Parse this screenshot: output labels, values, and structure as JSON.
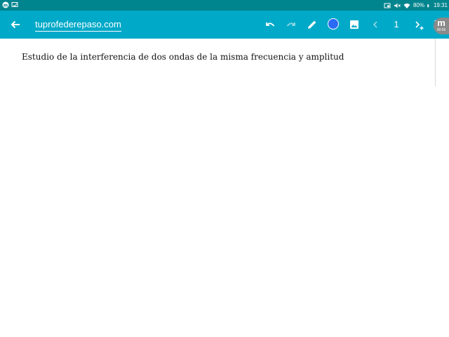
{
  "status_bar": {
    "battery": "80%",
    "time": "19:31"
  },
  "toolbar": {
    "url": "tuprofederepaso.com",
    "page_number": "1",
    "color": "#2a6af5",
    "icons": [
      "back-arrow-icon",
      "undo-icon",
      "redo-icon",
      "pencil-icon",
      "color-picker",
      "image-icon",
      "previous-page-icon",
      "page-number",
      "next-page-add-icon",
      "more-icon"
    ]
  },
  "floating_badge": {
    "time": "00:05"
  },
  "document": {
    "title": "Estudio de la interferencia de dos ondas de la misma frecuencia y amplitud"
  }
}
